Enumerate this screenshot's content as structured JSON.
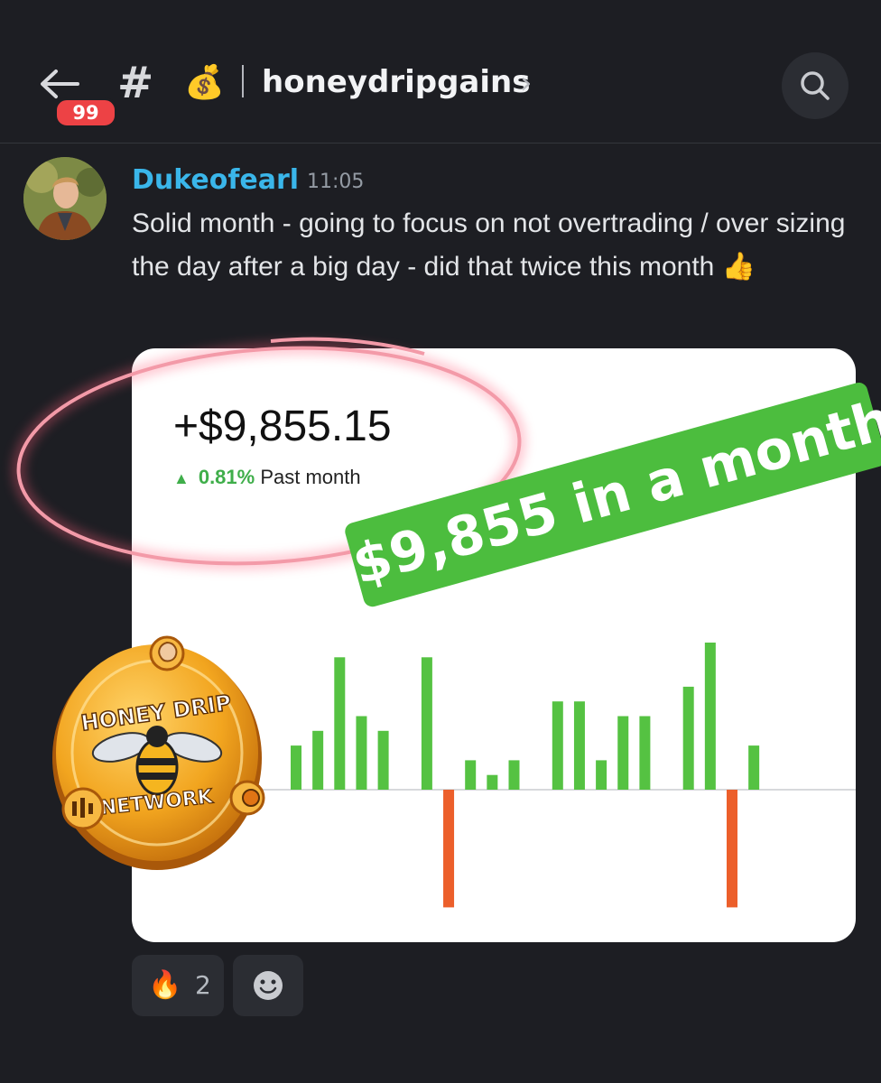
{
  "header": {
    "unread_badge": "99",
    "hash_symbol": "#",
    "channel_emoji": "💰",
    "channel_name": "honeydripgains",
    "chevron": "›"
  },
  "message": {
    "author": "Dukeofearl",
    "time": "11:05",
    "text": "Solid month - going to focus on not overtrading / over sizing the day after a big day - did that twice this month 👍"
  },
  "card": {
    "amount": "+$9,855.15",
    "change_pct": "0.81%",
    "change_period": "Past month",
    "promo_text": "$9,855 in a month",
    "logo_text_top": "HONEY DRIP",
    "logo_text_bottom": "NETWORK"
  },
  "chart_data": {
    "type": "bar",
    "values": [
      3,
      4,
      9,
      5,
      4,
      0,
      9,
      -8,
      2,
      1,
      2,
      0,
      6,
      6,
      2,
      5,
      5,
      0,
      7,
      10,
      -8,
      3
    ],
    "colors": {
      "positive": "#55c242",
      "negative": "#ec5f2b"
    },
    "grid": false
  },
  "reactions": [
    {
      "emoji": "🔥",
      "count": "2"
    }
  ],
  "colors": {
    "background": "#1d1e23",
    "username": "#3ab6ea",
    "badge": "#ed4245",
    "promo": "#4cbd3e"
  },
  "icons": [
    "arrow-left-icon",
    "search-icon",
    "add-reaction-icon"
  ]
}
